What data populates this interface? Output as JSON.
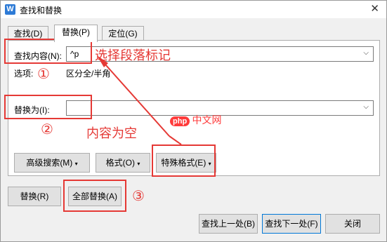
{
  "window": {
    "title": "查找和替换",
    "app_icon_glyph": "W",
    "close_glyph": "✕"
  },
  "tabs": [
    {
      "label": "查找(D)"
    },
    {
      "label": "替换(P)"
    },
    {
      "label": "定位(G)"
    }
  ],
  "find": {
    "label": "查找内容(N):",
    "value": "^p"
  },
  "options": {
    "label": "选项:",
    "value": "区分全/半角"
  },
  "replace": {
    "label": "替换为(I):",
    "value": ""
  },
  "buttons": {
    "advanced_search": "高级搜索(M)",
    "format": "格式(O)",
    "special_format": "特殊格式(E)",
    "replace": "替换(R)",
    "replace_all": "全部替换(A)",
    "find_prev": "查找上一处(B)",
    "find_next": "查找下一处(F)",
    "close": "关闭"
  },
  "annotations": {
    "select_paragraph_mark": "选择段落标记",
    "step1": "①",
    "step2": "②",
    "step3": "③",
    "empty_content": "内容为空"
  },
  "watermark": {
    "brand": "php",
    "text": "中文网"
  },
  "colors": {
    "annotation_red": "#e53935",
    "primary_border": "#0078d7"
  }
}
